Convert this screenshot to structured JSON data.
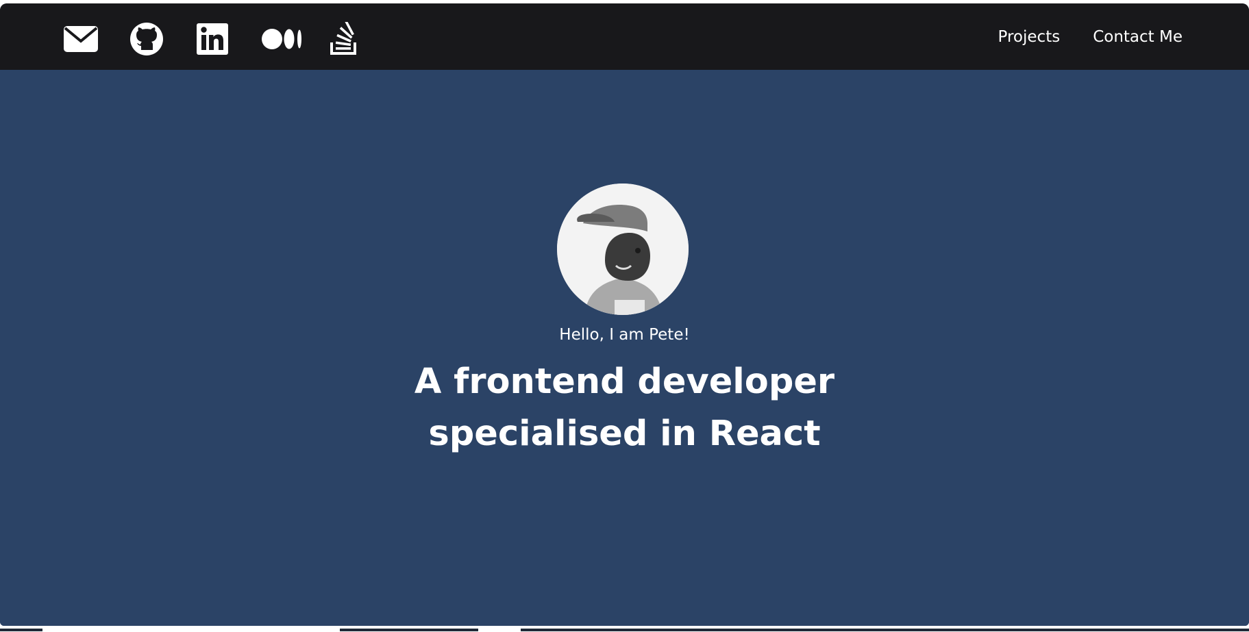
{
  "social_icons": [
    {
      "icon": "envelope-icon",
      "name": "email-link"
    },
    {
      "icon": "github-icon",
      "name": "github-link"
    },
    {
      "icon": "linkedin-icon",
      "name": "linkedin-link"
    },
    {
      "icon": "medium-icon",
      "name": "medium-link"
    },
    {
      "icon": "stack-overflow-icon",
      "name": "stack-overflow-link"
    }
  ],
  "nav": {
    "projects_label": "Projects",
    "contact_label": "Contact Me"
  },
  "hero": {
    "avatar_icon": "profile-photo",
    "greeting": "Hello, I am Pete!",
    "headline_line1": "A frontend developer",
    "headline_line2": "specialised in React"
  },
  "colors": {
    "navbar_bg": "#18181b",
    "hero_bg": "#2b4366",
    "text": "#ffffff"
  }
}
